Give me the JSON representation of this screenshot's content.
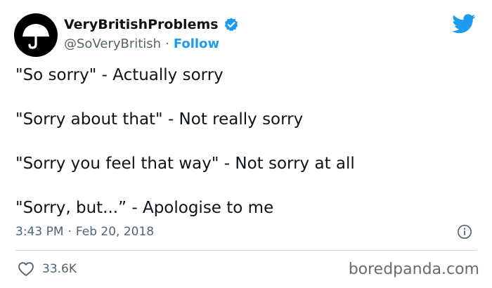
{
  "author": {
    "display_name": "VeryBritishProblems",
    "handle": "@SoVeryBritish",
    "separator": "·",
    "follow_label": "Follow",
    "avatar_icon": "umbrella-icon",
    "verified_icon": "verified-badge-icon"
  },
  "platform_icon": "twitter-bird-icon",
  "tweet": {
    "lines": [
      "\"So sorry\" - Actually sorry",
      "\"Sorry about that\" - Not really sorry",
      "\"Sorry you feel that way\" - Not sorry at all",
      "\"Sorry, but...” - Apologise to me"
    ]
  },
  "meta": {
    "time": "3:43 PM",
    "separator": "·",
    "date": "Feb 20, 2018",
    "info_icon": "info-icon"
  },
  "actions": {
    "like_icon": "heart-icon",
    "like_count": "33.6K"
  },
  "watermark": "boredpanda.com",
  "colors": {
    "accent": "#1d9bf0",
    "secondary_text": "#536471",
    "primary_text": "#0f1419",
    "divider": "#cfd9de"
  }
}
